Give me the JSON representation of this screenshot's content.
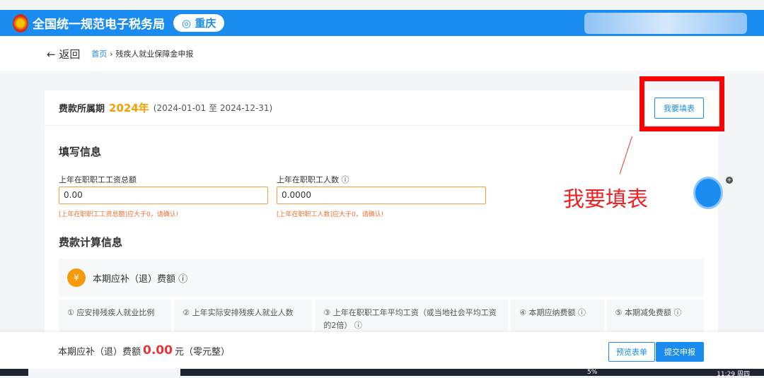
{
  "header": {
    "site_title": "全国统一规范电子税务局",
    "region": "重庆"
  },
  "nav": {
    "back": "← 返回",
    "home": "首页",
    "separator": "›",
    "current": "残疾人就业保障金申报"
  },
  "period": {
    "label": "费款所属期",
    "year": "2024年",
    "range": "(2024-01-01 至 2024-12-31)",
    "fill_button": "我要填表"
  },
  "form": {
    "title": "填写信息",
    "wage_label": "上年在职职工工资总额",
    "wage_value": "0.00",
    "wage_error": "[上年在职职工工资总额]应大于0，请确认!",
    "count_label": "上年在职职工人数 ⓘ",
    "count_value": "0.0000",
    "count_error": "[上年在职职工人数]应大于0，请确认!"
  },
  "calc": {
    "title": "费款计算信息",
    "fee_title": "本期应补（退）费额 ⓘ",
    "coin": "¥",
    "columns": [
      "① 应安排残疾人就业比例",
      "② 上年实际安排残疾人就业人数",
      "③ 上年在职职工年平均工资（或当地社会平均工资的2倍） ⓘ",
      "④ 本期应纳费额 ⓘ",
      "⑤ 本期减免费额 ⓘ"
    ]
  },
  "footer": {
    "label": "本期应补（退）费额",
    "amount": "0.00",
    "unit": "元",
    "words": "（零元整）",
    "preview": "预览表单",
    "submit": "提交申报"
  },
  "annotation": {
    "text": "我要填表"
  },
  "taskbar": {
    "percent": "5%",
    "time": "11:29 周四"
  }
}
